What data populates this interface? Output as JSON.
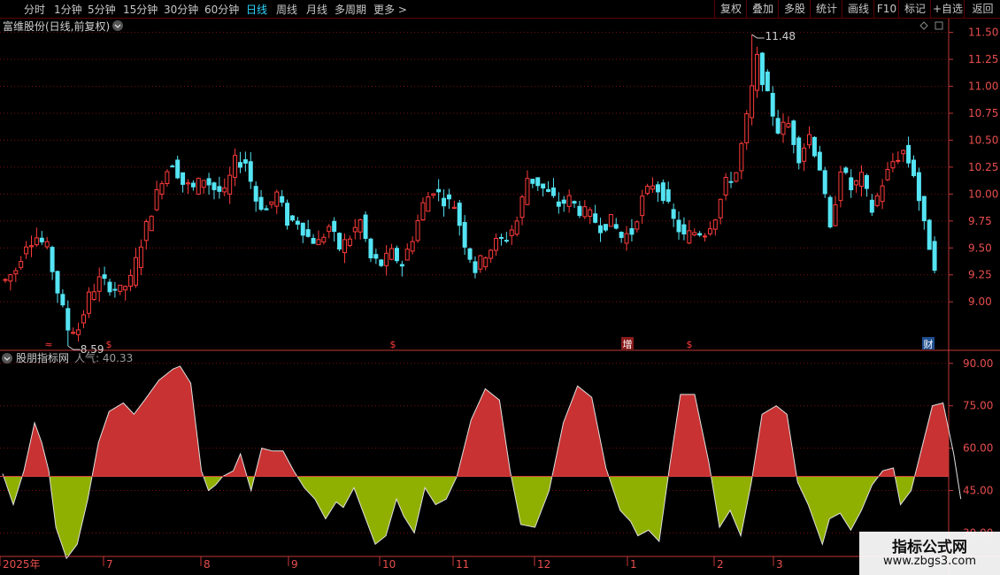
{
  "toolbar": {
    "periods": [
      "分时",
      "1分钟",
      "5分钟",
      "15分钟",
      "30分钟",
      "60分钟",
      "日线",
      "周线",
      "月线",
      "多周期",
      "更多 >"
    ],
    "active_period": "日线",
    "right_buttons": [
      "复权",
      "叠加",
      "多股",
      "统计",
      "画线",
      "F10",
      "标记",
      "+自选",
      "返回"
    ]
  },
  "colors": {
    "up": "#ff3b3b",
    "down": "#54e4f4",
    "pos_fill": "#c83232",
    "neg_fill": "#8fb000",
    "grid": "#7a0f0f",
    "axis": "#c23636",
    "label": "#e84e4e"
  },
  "chart_data": [
    {
      "type": "candlestick",
      "title": "富维股份(日线,前复权)",
      "ylim": [
        8.55,
        11.62
      ],
      "yticks": [
        9.0,
        9.25,
        9.5,
        9.75,
        10.0,
        10.25,
        10.5,
        10.75,
        11.0,
        11.25,
        11.5
      ],
      "x_labels": [
        "2025年",
        "7",
        "8",
        "9",
        "10",
        "11",
        "12",
        "1",
        "2",
        "3"
      ],
      "annotations": [
        {
          "text": "11.48",
          "value": 11.48
        },
        {
          "text": "8.59",
          "value": 8.59
        }
      ],
      "markers": [
        "≈",
        "$",
        "$",
        "增",
        "$",
        "财"
      ],
      "trend": [
        [
          0,
          9.2
        ],
        [
          2,
          9.3
        ],
        [
          4,
          9.55
        ],
        [
          6,
          9.6
        ],
        [
          8,
          9.5
        ],
        [
          10,
          9.1
        ],
        [
          12,
          8.75
        ],
        [
          14,
          8.75
        ],
        [
          16,
          9.05
        ],
        [
          18,
          9.2
        ],
        [
          20,
          9.15
        ],
        [
          22,
          9.1
        ],
        [
          24,
          9.2
        ],
        [
          26,
          9.55
        ],
        [
          28,
          9.85
        ],
        [
          30,
          10.15
        ],
        [
          32,
          10.3
        ],
        [
          34,
          10.1
        ],
        [
          36,
          10.05
        ],
        [
          38,
          10.15
        ],
        [
          40,
          10.05
        ],
        [
          42,
          10.0
        ],
        [
          44,
          10.3
        ],
        [
          46,
          10.3
        ],
        [
          48,
          9.95
        ],
        [
          50,
          9.85
        ],
        [
          52,
          10.0
        ],
        [
          54,
          9.75
        ],
        [
          56,
          9.75
        ],
        [
          58,
          9.6
        ],
        [
          60,
          9.55
        ],
        [
          62,
          9.7
        ],
        [
          64,
          9.5
        ],
        [
          66,
          9.6
        ],
        [
          68,
          9.75
        ],
        [
          70,
          9.4
        ],
        [
          72,
          9.35
        ],
        [
          74,
          9.45
        ],
        [
          76,
          9.35
        ],
        [
          78,
          9.6
        ],
        [
          80,
          9.9
        ],
        [
          82,
          10.05
        ],
        [
          84,
          9.95
        ],
        [
          86,
          9.9
        ],
        [
          88,
          9.55
        ],
        [
          90,
          9.3
        ],
        [
          92,
          9.45
        ],
        [
          94,
          9.55
        ],
        [
          96,
          9.6
        ],
        [
          98,
          9.75
        ],
        [
          100,
          10.15
        ],
        [
          102,
          10.1
        ],
        [
          104,
          10.0
        ],
        [
          106,
          9.9
        ],
        [
          108,
          9.95
        ],
        [
          110,
          9.85
        ],
        [
          112,
          9.8
        ],
        [
          114,
          9.7
        ],
        [
          116,
          9.75
        ],
        [
          118,
          9.6
        ],
        [
          120,
          9.65
        ],
        [
          122,
          9.95
        ],
        [
          124,
          10.1
        ],
        [
          126,
          10.0
        ],
        [
          128,
          9.75
        ],
        [
          130,
          9.6
        ],
        [
          132,
          9.65
        ],
        [
          134,
          9.65
        ],
        [
          136,
          9.8
        ],
        [
          138,
          10.1
        ],
        [
          140,
          10.2
        ],
        [
          142,
          10.7
        ],
        [
          144,
          11.25
        ],
        [
          146,
          10.9
        ],
        [
          148,
          10.6
        ],
        [
          150,
          10.65
        ],
        [
          152,
          10.35
        ],
        [
          154,
          10.55
        ],
        [
          156,
          10.25
        ],
        [
          158,
          9.65
        ],
        [
          160,
          10.25
        ],
        [
          162,
          10.05
        ],
        [
          164,
          10.15
        ],
        [
          166,
          9.85
        ],
        [
          168,
          10.1
        ],
        [
          170,
          10.3
        ],
        [
          172,
          10.4
        ],
        [
          174,
          10.2
        ],
        [
          176,
          9.7
        ],
        [
          178,
          9.35
        ]
      ],
      "lows": [
        {
          "i": 12,
          "v": 8.59
        }
      ],
      "highs": [
        {
          "i": 143,
          "v": 11.48
        }
      ]
    },
    {
      "type": "area",
      "title": "股朋指标网",
      "series_name": "人气",
      "last_value": "40.33",
      "baseline": 50,
      "ylim": [
        22,
        94
      ],
      "yticks": [
        30.0,
        45.0,
        60.0,
        75.0,
        90.0
      ],
      "values": [
        [
          0,
          51
        ],
        [
          3,
          40
        ],
        [
          6,
          52
        ],
        [
          9,
          69
        ],
        [
          11,
          62
        ],
        [
          13,
          52
        ],
        [
          15,
          32
        ],
        [
          18,
          21
        ],
        [
          21,
          26
        ],
        [
          24,
          42
        ],
        [
          27,
          62
        ],
        [
          30,
          73
        ],
        [
          34,
          76
        ],
        [
          37,
          72
        ],
        [
          40,
          77
        ],
        [
          44,
          84
        ],
        [
          48,
          88
        ],
        [
          50,
          89
        ],
        [
          53,
          83
        ],
        [
          56,
          52
        ],
        [
          58,
          45
        ],
        [
          60,
          47
        ],
        [
          62,
          50
        ],
        [
          65,
          52
        ],
        [
          67,
          58
        ],
        [
          70,
          45
        ],
        [
          73,
          60
        ],
        [
          76,
          59
        ],
        [
          79,
          59
        ],
        [
          82,
          52
        ],
        [
          85,
          46
        ],
        [
          88,
          42
        ],
        [
          91,
          35
        ],
        [
          94,
          41
        ],
        [
          96,
          39
        ],
        [
          99,
          46
        ],
        [
          102,
          36
        ],
        [
          105,
          26
        ],
        [
          108,
          29
        ],
        [
          111,
          42
        ],
        [
          113,
          36
        ],
        [
          116,
          30
        ],
        [
          119,
          46
        ],
        [
          122,
          40
        ],
        [
          125,
          42
        ],
        [
          128,
          50
        ],
        [
          132,
          70
        ],
        [
          136,
          81
        ],
        [
          140,
          77
        ],
        [
          143,
          52
        ],
        [
          146,
          33
        ],
        [
          150,
          32
        ],
        [
          154,
          45
        ],
        [
          158,
          69
        ],
        [
          162,
          82
        ],
        [
          166,
          78
        ],
        [
          170,
          53
        ],
        [
          174,
          38
        ],
        [
          177,
          34
        ],
        [
          179,
          29
        ],
        [
          182,
          31
        ],
        [
          185,
          27
        ],
        [
          188,
          54
        ],
        [
          191,
          79
        ],
        [
          195,
          79
        ],
        [
          199,
          55
        ],
        [
          202,
          32
        ],
        [
          205,
          38
        ],
        [
          208,
          29
        ],
        [
          211,
          48
        ],
        [
          214,
          72
        ],
        [
          218,
          75
        ],
        [
          221,
          72
        ],
        [
          224,
          48
        ],
        [
          227,
          40
        ],
        [
          229,
          33
        ],
        [
          231,
          26
        ],
        [
          233,
          35
        ],
        [
          236,
          37
        ],
        [
          239,
          31
        ],
        [
          242,
          38
        ],
        [
          245,
          47
        ],
        [
          248,
          52
        ],
        [
          251,
          53
        ],
        [
          253,
          40
        ],
        [
          256,
          45
        ],
        [
          259,
          60
        ],
        [
          262,
          75
        ],
        [
          265,
          76
        ],
        [
          268,
          58
        ],
        [
          270,
          42
        ]
      ]
    }
  ],
  "watermark": {
    "line1": "指标公式网",
    "line2": "www.zbgs3.com"
  }
}
